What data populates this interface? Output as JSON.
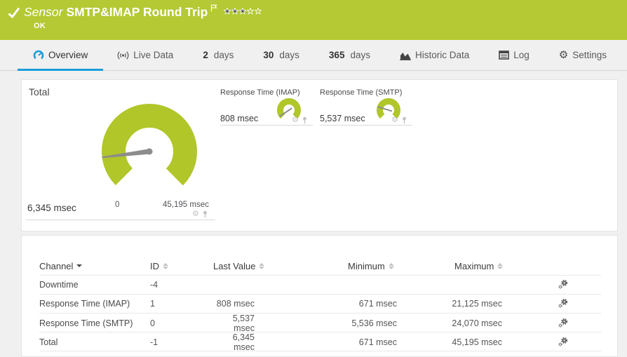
{
  "colors": {
    "banner_green": "#b4c933",
    "gauge_green": "#b1c629",
    "accent_blue": "#1b9dd9",
    "needle_gray": "#8c8c8c"
  },
  "icons": {
    "gear": "⚙",
    "check": "✓"
  },
  "header": {
    "kind_label": "Sensor",
    "title": "SMTP&IMAP Round Trip",
    "status": "OK",
    "priority_filled": 3,
    "priority_total": 5
  },
  "tabs": [
    {
      "label": "Overview",
      "icon": "gauge-icon",
      "active": true
    },
    {
      "label": "Live Data",
      "icon": "broadcast-icon"
    },
    {
      "prefix": "2",
      "suffix": "days"
    },
    {
      "prefix": "30",
      "suffix": "days"
    },
    {
      "prefix": "365",
      "suffix": "days"
    },
    {
      "label": "Historic Data",
      "icon": "area-chart-icon"
    },
    {
      "label": "Log",
      "icon": "log-icon"
    },
    {
      "label": "Settings",
      "icon": "gear-icon"
    }
  ],
  "gauges": {
    "total": {
      "title": "Total",
      "value": 6345,
      "max": 45195,
      "value_label": "6,345 msec",
      "min_label": "0",
      "max_label": "45,195 msec"
    },
    "imap": {
      "title": "Response Time (IMAP)",
      "value": 808,
      "max": 21125,
      "value_label": "808 msec"
    },
    "smtp": {
      "title": "Response Time (SMTP)",
      "value": 5537,
      "max": 24070,
      "value_label": "5,537 msec"
    }
  },
  "table": {
    "columns": {
      "channel": "Channel",
      "id": "ID",
      "last": "Last Value",
      "min": "Minimum",
      "max": "Maximum"
    },
    "sorted_by": "Channel",
    "rows": [
      {
        "channel": "Downtime",
        "id": "-4",
        "last": "",
        "min": "",
        "max": ""
      },
      {
        "channel": "Response Time (IMAP)",
        "id": "1",
        "last": "808 msec",
        "min": "671 msec",
        "max": "21,125 msec"
      },
      {
        "channel": "Response Time (SMTP)",
        "id": "0",
        "last": "5,537 msec",
        "min": "5,536 msec",
        "max": "24,070 msec"
      },
      {
        "channel": "Total",
        "id": "-1",
        "last": "6,345 msec",
        "min": "671 msec",
        "max": "45,195 msec"
      }
    ]
  }
}
